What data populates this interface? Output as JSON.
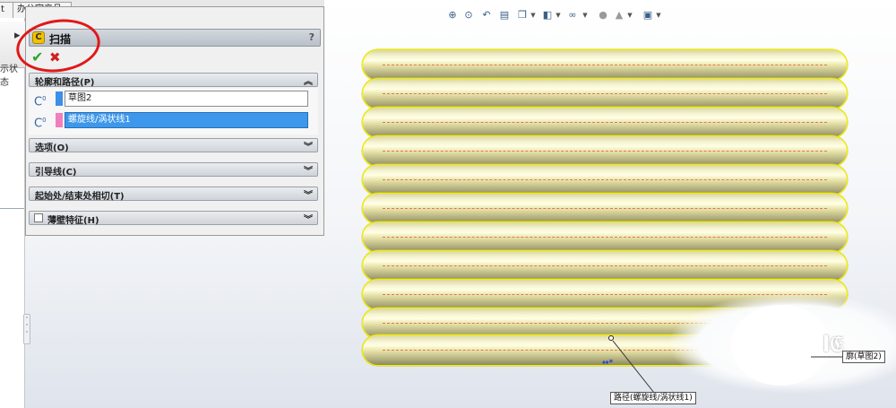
{
  "tabs": [
    {
      "label": "t"
    },
    {
      "label": "办公室产品"
    }
  ],
  "left_panel": {
    "display_state_label": "示状态"
  },
  "property_manager": {
    "title": "扫描",
    "help_label": "?",
    "ok_icon": "check-icon",
    "cancel_icon": "x-icon",
    "groups": {
      "profile_path": {
        "label": "轮廓和路径(P)",
        "state": "expanded",
        "profile_value": "草图2",
        "path_value": "螺旋线/涡状线1",
        "profile_color": "#3e8fe8",
        "path_color": "#f07fbf"
      },
      "options": {
        "label": "选项(O)",
        "state": "collapsed"
      },
      "guide_curves": {
        "label": "引导线(C)",
        "state": "collapsed"
      },
      "tangency": {
        "label": "起始处/结束处相切(T)",
        "state": "collapsed"
      },
      "thin_feature": {
        "label": "薄壁特征(H)",
        "state": "collapsed",
        "checked": false
      }
    }
  },
  "hud_toolbar": {
    "icons": [
      "zoom-fit-icon",
      "zoom-area-icon",
      "previous-view-icon",
      "section-view-icon",
      "view-orientation-icon",
      "display-style-icon",
      "hide-show-icon",
      "edit-appearance-icon",
      "scene-icon",
      "view-settings-icon"
    ]
  },
  "graphics": {
    "coil_turns": 10,
    "coil_color": "#f2ee00",
    "path_callout": "路径(螺旋线/涡状线1)",
    "profile_callout": "廓(草图2)"
  },
  "annotation_color": "#e01818"
}
